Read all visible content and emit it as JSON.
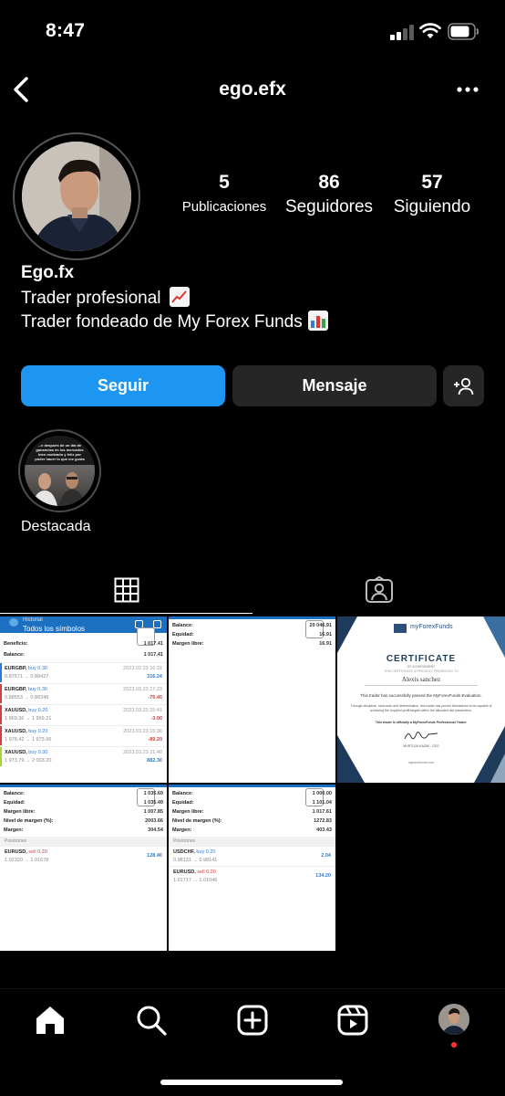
{
  "status_bar": {
    "time": "8:47"
  },
  "header": {
    "username": "ego.efx"
  },
  "profile": {
    "stats": [
      {
        "value": "5",
        "label": "Publicaciones"
      },
      {
        "value": "86",
        "label": "Seguidores"
      },
      {
        "value": "57",
        "label": "Siguiendo"
      }
    ],
    "display_name": "Ego.fx",
    "bio_lines": [
      "Trader profesional",
      "Trader fondeado de My Forex Funds"
    ]
  },
  "actions": {
    "follow_label": "Seguir",
    "message_label": "Mensaje"
  },
  "highlight": {
    "label": "Destacada",
    "cover_text": "...e después de un día de ganancias en los mercados bien motivado y feliz por poder hacer lo que me gusta"
  },
  "tabs": [
    {
      "name": "posts",
      "icon": "grid-icon",
      "active": true
    },
    {
      "name": "tagged",
      "icon": "tagged-person-icon",
      "active": false
    }
  ],
  "posts": {
    "post1": {
      "title_small": "Historial",
      "title": "Todos los símbolos",
      "rows": [
        {
          "label": "Beneficio:",
          "value": "1 017.41"
        },
        {
          "label": "Balance:",
          "value": "1 017.41"
        }
      ],
      "trades": [
        {
          "symbol": "EURGBP,",
          "side": "buy 0.30",
          "prices": "0.87571 → 0.88427",
          "date": "2023.02.23 16:31",
          "pl": "316.24",
          "color": "#2a7bd6"
        },
        {
          "symbol": "EURGBP,",
          "side": "buy 0.30",
          "prices": "0.88553 → 0.88349",
          "date": "2023.03.23 17:23",
          "pl": "-75.40",
          "color": "#d04040"
        },
        {
          "symbol": "XAUUSD,",
          "side": "buy 0.20",
          "prices": "1 969.36 → 1 969.21",
          "date": "2023.03.23 15:41",
          "pl": "-3.00",
          "color": "#d04040"
        },
        {
          "symbol": "XAUUSD,",
          "side": "buy 0.20",
          "prices": "1 978.42 → 1 973.96",
          "date": "2023.03.23 15:36",
          "pl": "-89.20",
          "color": "#d04040"
        },
        {
          "symbol": "XAUUSD,",
          "side": "buy 0.30",
          "prices": "1 973.79 → 2 003.20",
          "date": "2023.03.23 21:40",
          "pl": "882.30",
          "color": "#2a7bd6"
        }
      ]
    },
    "post2": {
      "rows": [
        {
          "label": "Balance:",
          "value": "20 046.91"
        },
        {
          "label": "Equidad:",
          "value": "16.91"
        },
        {
          "label": "Margen libre:",
          "value": "16.91"
        }
      ]
    },
    "post3": {
      "brand": "myForexFunds",
      "title": "CERTIFICATE",
      "subtitle": "OF ACHIEVEMENT",
      "presented": "THIS CERTIFICATE IS PROUDLY PRESENTED TO",
      "name": "Alexis sanchez",
      "line1": "This trader has successfully passed the MyForexFunds Evaluation.",
      "line2": "Through discipline, hard work and determination, this trader has proven themselves to be capable of achieving the required profit targets within the allocated risk parameters.",
      "line3": "This trader is officially a MyForexFunds Professional Trader.",
      "signer": "MURTUZA KAZMI - CEO",
      "url": "myforexfunds.com"
    },
    "post4": {
      "rows": [
        {
          "label": "Balance:",
          "value": "1 035.69"
        },
        {
          "label": "Equidad:",
          "value": "1 035.49"
        },
        {
          "label": "Margen libre:",
          "value": "1 007.85"
        },
        {
          "label": "Nivel de margen (%):",
          "value": "2003.66"
        },
        {
          "label": "Margen:",
          "value": "304.54"
        }
      ],
      "section": "Posiciones",
      "trades": [
        {
          "symbol": "EURUSD,",
          "side": "sell 0.20",
          "prices": "1.02320 → 1.01678",
          "pl": "128.40",
          "color": "#2a7bd6"
        }
      ]
    },
    "post5": {
      "rows": [
        {
          "label": "Balance:",
          "value": "1 000.00"
        },
        {
          "label": "Equidad:",
          "value": "1 101.04"
        },
        {
          "label": "Margen libre:",
          "value": "1 017.61"
        },
        {
          "label": "Nivel de margen (%):",
          "value": "1272.83"
        },
        {
          "label": "Margen:",
          "value": "403.43"
        }
      ],
      "section": "Posiciones",
      "trades": [
        {
          "symbol": "USDCHF,",
          "side": "buy 0.20",
          "prices": "0.98131 → 0.98141",
          "pl": "2.04",
          "color": "#2a7bd6"
        },
        {
          "symbol": "EURUSD,",
          "side": "sell 0.20",
          "prices": "1.01717 → 1.01046",
          "pl": "134.20",
          "color": "#2a7bd6"
        }
      ]
    }
  },
  "bottom_nav": [
    {
      "name": "home",
      "icon": "home-icon"
    },
    {
      "name": "search",
      "icon": "search-icon"
    },
    {
      "name": "create",
      "icon": "plus-square-icon"
    },
    {
      "name": "reels",
      "icon": "reels-icon"
    },
    {
      "name": "profile",
      "icon": "profile-avatar"
    }
  ],
  "colors": {
    "accent": "#1c96f0",
    "secondary_button": "#262626",
    "background": "#000000"
  }
}
